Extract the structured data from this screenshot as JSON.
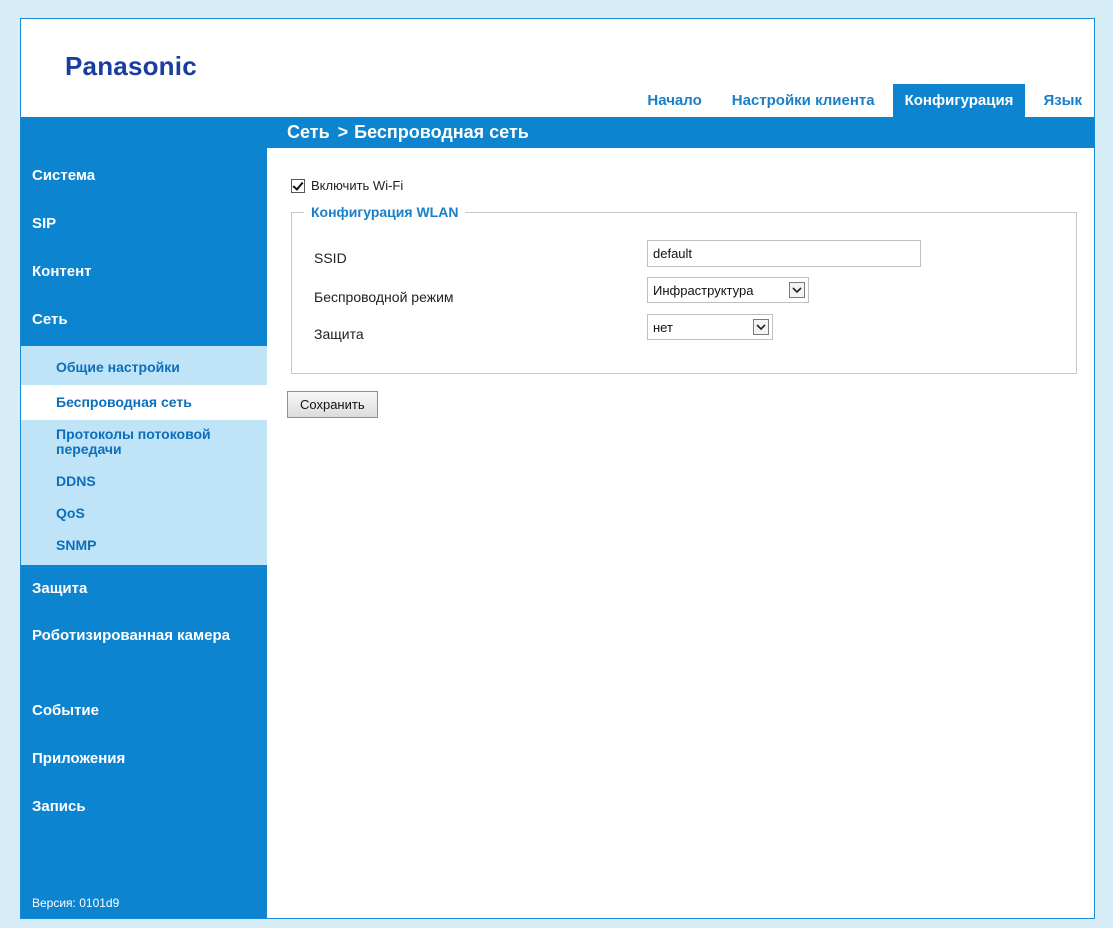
{
  "brand": {
    "logo": "Panasonic"
  },
  "top_nav": {
    "tabs": [
      {
        "label": "Начало",
        "active": false
      },
      {
        "label": "Настройки клиента",
        "active": false
      },
      {
        "label": "Конфигурация",
        "active": true
      },
      {
        "label": "Язык",
        "active": false
      }
    ]
  },
  "breadcrumb": {
    "section": "Сеть",
    "separator": ">",
    "page": "Беспроводная сеть"
  },
  "sidebar": {
    "items": [
      {
        "label": "Система"
      },
      {
        "label": "SIP"
      },
      {
        "label": "Контент"
      },
      {
        "label": "Сеть",
        "expanded": true
      },
      {
        "label": "Защита"
      },
      {
        "label": "Роботизированная камера"
      },
      {
        "label": "Событие"
      },
      {
        "label": "Приложения"
      },
      {
        "label": "Запись"
      }
    ],
    "submenu": [
      {
        "label": "Общие настройки",
        "active": false
      },
      {
        "label": "Беспроводная сеть",
        "active": true
      },
      {
        "label": "Протоколы потоковой передачи",
        "active": false
      },
      {
        "label": "DDNS",
        "active": false
      },
      {
        "label": "QoS",
        "active": false
      },
      {
        "label": "SNMP",
        "active": false
      }
    ],
    "version": "Версия: 0101d9"
  },
  "form": {
    "enable_wifi": {
      "label": "Включить Wi-Fi",
      "checked": true
    },
    "wlan_group": {
      "legend": "Конфигурация WLAN",
      "ssid": {
        "label": "SSID",
        "value": "default"
      },
      "mode": {
        "label": "Беспроводной режим",
        "value": "Инфраструктура"
      },
      "security": {
        "label": "Защита",
        "value": "нет"
      }
    },
    "save_label": "Сохранить"
  },
  "colors": {
    "primary_blue": "#0d84cf",
    "submenu_bg": "#bfe3f7",
    "logo_blue": "#1a3ea0",
    "link_blue": "#1a7fc8",
    "outer_bg": "#d6ecf7"
  }
}
